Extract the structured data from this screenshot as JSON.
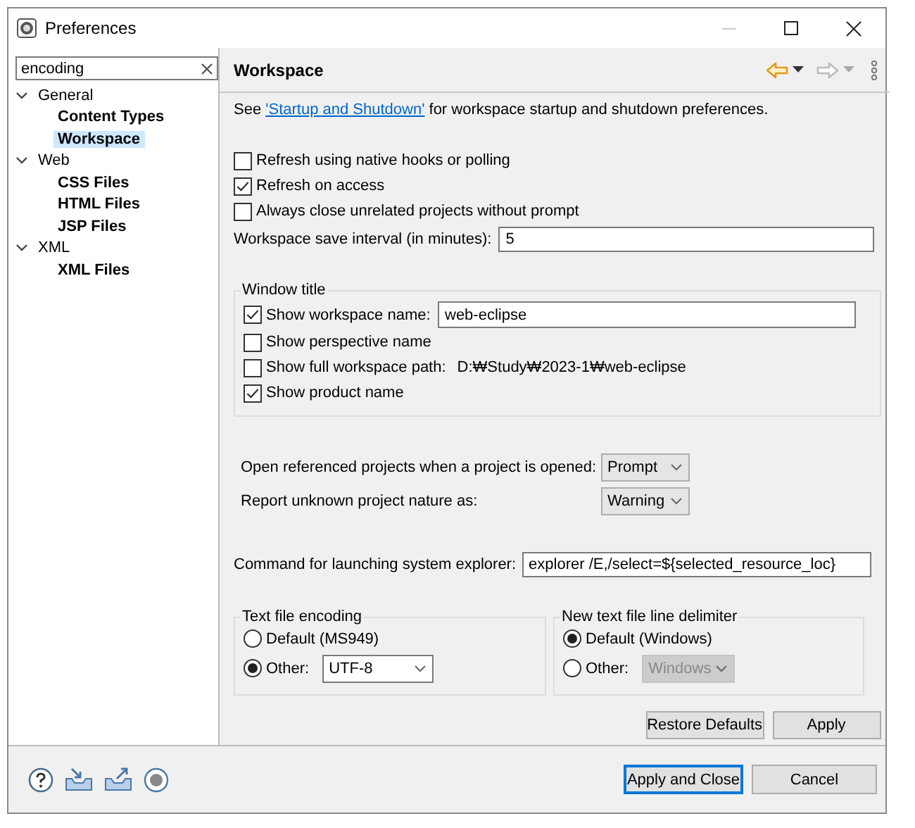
{
  "window": {
    "title": "Preferences"
  },
  "filter": {
    "value": "encoding"
  },
  "tree": [
    {
      "label": "General",
      "expanded": true,
      "selected": false,
      "children": [
        {
          "label": "Content Types",
          "selected": false
        },
        {
          "label": "Workspace",
          "selected": true
        }
      ]
    },
    {
      "label": "Web",
      "expanded": true,
      "selected": false,
      "children": [
        {
          "label": "CSS Files",
          "selected": false
        },
        {
          "label": "HTML Files",
          "selected": false
        },
        {
          "label": "JSP Files",
          "selected": false
        }
      ]
    },
    {
      "label": "XML",
      "expanded": true,
      "selected": false,
      "children": [
        {
          "label": "XML Files",
          "selected": false
        }
      ]
    }
  ],
  "page": {
    "title": "Workspace",
    "intro": {
      "before": "See ",
      "link": "'Startup and Shutdown'",
      "after": " for workspace startup and shutdown preferences."
    },
    "options": [
      {
        "label": "Refresh using native hooks or polling",
        "checked": false
      },
      {
        "label": "Refresh on access",
        "checked": true
      },
      {
        "label": "Always close unrelated projects without prompt",
        "checked": false
      }
    ],
    "save_interval": {
      "label": "Workspace save interval (in minutes):",
      "value": "5"
    },
    "window_title": {
      "legend": "Window title",
      "items": [
        {
          "label": "Show workspace name:",
          "checked": true,
          "value": "web-eclipse"
        },
        {
          "label": "Show perspective name",
          "checked": false
        },
        {
          "label": "Show full workspace path:",
          "checked": false,
          "path": "D:₩Study₩2023-1₩web-eclipse"
        },
        {
          "label": "Show product name",
          "checked": true
        }
      ]
    },
    "dropdowns": [
      {
        "label": "Open referenced projects when a project is opened:",
        "value": "Prompt"
      },
      {
        "label": "Report unknown project nature as:",
        "value": "Warning"
      }
    ],
    "explorer": {
      "label": "Command for launching system explorer:",
      "value": "explorer /E,/select=${selected_resource_loc}"
    },
    "encoding": {
      "legend": "Text file encoding",
      "options": [
        {
          "label": "Default (MS949)",
          "selected": false
        },
        {
          "label": "Other:",
          "selected": true,
          "value": "UTF-8",
          "disabled": false
        }
      ]
    },
    "delimiter": {
      "legend": "New text file line delimiter",
      "options": [
        {
          "label": "Default (Windows)",
          "selected": true
        },
        {
          "label": "Other:",
          "selected": false,
          "value": "Windows",
          "disabled": true
        }
      ]
    },
    "buttons": [
      "Restore Defaults",
      "Apply"
    ]
  },
  "footer_buttons": [
    {
      "label": "Apply and Close",
      "default": true
    },
    {
      "label": "Cancel",
      "default": false
    }
  ]
}
